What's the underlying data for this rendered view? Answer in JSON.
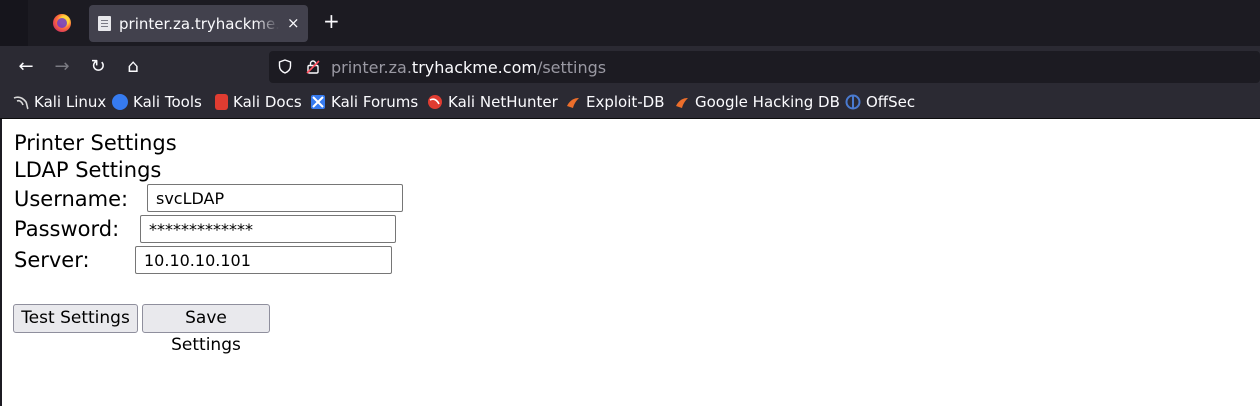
{
  "browser": {
    "tab": {
      "title": "printer.za.tryhackme.com/settings",
      "close_glyph": "×",
      "icon": "page-icon"
    },
    "new_tab_glyph": "+",
    "nav": {
      "back": "←",
      "forward": "→",
      "reload": "↻",
      "home": "⌂"
    },
    "url": {
      "prefix": "printer.za.",
      "host": "tryhackme.com",
      "path": "/settings"
    },
    "bookmarks": [
      {
        "label": "Kali Linux",
        "icon": "kali-dragon-icon",
        "color": "#d9d9d9"
      },
      {
        "label": "Kali Tools",
        "icon": "kali-tools-icon",
        "color": "#367bf0"
      },
      {
        "label": "Kali Docs",
        "icon": "kali-docs-icon",
        "color": "#e03c31"
      },
      {
        "label": "Kali Forums",
        "icon": "kali-forums-icon",
        "color": "#367bf0"
      },
      {
        "label": "Kali NetHunter",
        "icon": "kali-nethunter-icon",
        "color": "#e03c31"
      },
      {
        "label": "Exploit-DB",
        "icon": "exploit-db-icon",
        "color": "#ec6e2b"
      },
      {
        "label": "Google Hacking DB",
        "icon": "ghdb-icon",
        "color": "#ec6e2b"
      },
      {
        "label": "OffSec",
        "icon": "offsec-icon",
        "color": "#4a7bd0"
      }
    ]
  },
  "page": {
    "title": "Printer Settings",
    "subtitle": "LDAP Settings",
    "username_label": "Username:",
    "username_value": "svcLDAP",
    "password_label": "Password:",
    "password_value": "*************",
    "server_label": "Server:",
    "server_value": "10.10.10.101",
    "test_button": "Test Settings",
    "save_button": "Save Settings"
  }
}
